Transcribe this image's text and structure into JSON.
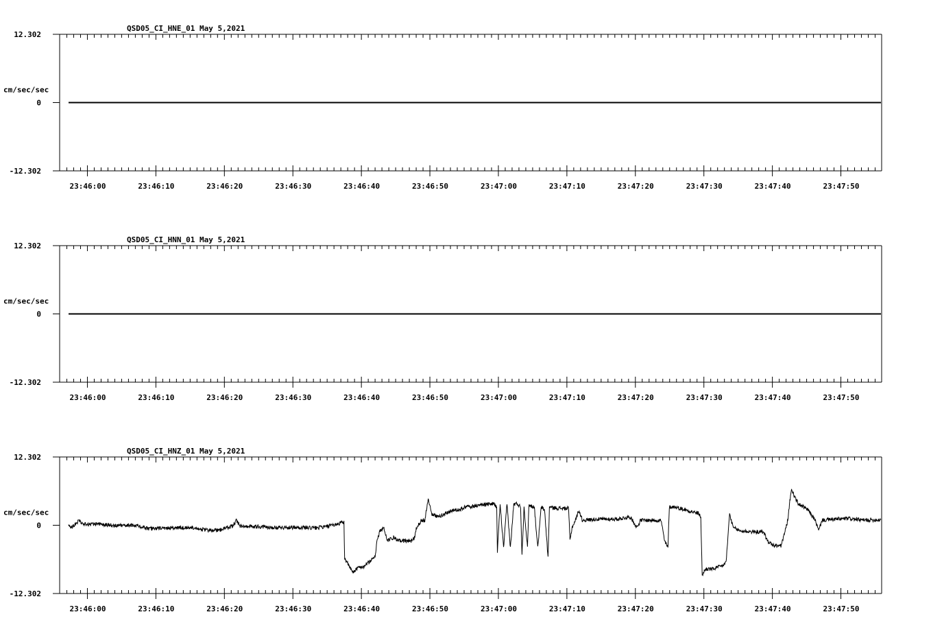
{
  "chart_data": [
    {
      "type": "line",
      "title": "QSD05_CI_HNE_01  May 5,2021",
      "ylabel": "cm/sec/sec",
      "ylim": [
        -12.302,
        12.302
      ],
      "yticks": [
        "12.302",
        "0",
        "-12.302"
      ],
      "x_start_time": "23:45:56",
      "x_range_seconds": [
        0,
        120
      ],
      "xtick_labels": [
        "23:46:00",
        "23:46:10",
        "23:46:20",
        "23:46:30",
        "23:46:40",
        "23:46:50",
        "23:47:00",
        "23:47:10",
        "23:47:20",
        "23:47:30",
        "23:47:40",
        "23:47:50"
      ],
      "series": [
        {
          "name": "HNE",
          "points": [
            [
              1.3,
              0
            ],
            [
              119.9,
              0
            ]
          ],
          "noise": 0
        }
      ]
    },
    {
      "type": "line",
      "title": "QSD05_CI_HNN_01  May 5,2021",
      "ylabel": "cm/sec/sec",
      "ylim": [
        -12.302,
        12.302
      ],
      "yticks": [
        "12.302",
        "0",
        "-12.302"
      ],
      "x_start_time": "23:45:56",
      "x_range_seconds": [
        0,
        120
      ],
      "xtick_labels": [
        "23:46:00",
        "23:46:10",
        "23:46:20",
        "23:46:30",
        "23:46:40",
        "23:46:50",
        "23:47:00",
        "23:47:10",
        "23:47:20",
        "23:47:30",
        "23:47:40",
        "23:47:50"
      ],
      "series": [
        {
          "name": "HNN",
          "points": [
            [
              1.3,
              0
            ],
            [
              119.9,
              0
            ]
          ],
          "noise": 0
        }
      ]
    },
    {
      "type": "line",
      "title": "QSD05_CI_HNZ_01  May 5,2021",
      "ylabel": "cm/sec/sec",
      "ylim": [
        -12.302,
        12.302
      ],
      "yticks": [
        "12.302",
        "0",
        "-12.302"
      ],
      "x_start_time": "23:45:56",
      "x_range_seconds": [
        0,
        120
      ],
      "xtick_labels": [
        "23:46:00",
        "23:46:10",
        "23:46:20",
        "23:46:30",
        "23:46:40",
        "23:46:50",
        "23:47:00",
        "23:47:10",
        "23:47:20",
        "23:47:30",
        "23:47:40",
        "23:47:50"
      ],
      "series": [
        {
          "name": "HNZ",
          "noise": 0.35,
          "points": [
            [
              1.3,
              0
            ],
            [
              1.8,
              -0.4
            ],
            [
              2.8,
              0.9
            ],
            [
              3.3,
              0.2
            ],
            [
              5.8,
              0.2
            ],
            [
              8.3,
              -0.1
            ],
            [
              11.3,
              0
            ],
            [
              12.8,
              -0.6
            ],
            [
              16.3,
              -0.5
            ],
            [
              19.8,
              -0.4
            ],
            [
              21.3,
              -0.9
            ],
            [
              23.3,
              -0.9
            ],
            [
              25.3,
              -0.1
            ],
            [
              25.8,
              0.9
            ],
            [
              26.3,
              -0.1
            ],
            [
              31.3,
              -0.4
            ],
            [
              34.3,
              -0.4
            ],
            [
              37.3,
              -0.5
            ],
            [
              39.3,
              -0.2
            ],
            [
              41.3,
              0.5
            ],
            [
              41.5,
              0.5
            ],
            [
              41.6,
              -5.9
            ],
            [
              42.3,
              -7.5
            ],
            [
              42.8,
              -8.5
            ],
            [
              43.3,
              -7.9
            ],
            [
              43.8,
              -7.5
            ],
            [
              44.3,
              -7.5
            ],
            [
              45.3,
              -6.5
            ],
            [
              46.1,
              -5.5
            ],
            [
              46.3,
              -2.8
            ],
            [
              46.8,
              -1.0
            ],
            [
              47.3,
              -0.4
            ],
            [
              47.8,
              -2.8
            ],
            [
              48.8,
              -2.2
            ],
            [
              49.3,
              -2.8
            ],
            [
              51.3,
              -2.8
            ],
            [
              51.8,
              -2.2
            ],
            [
              52.1,
              -0.4
            ],
            [
              52.8,
              0.9
            ],
            [
              53.3,
              0.9
            ],
            [
              53.8,
              4.8
            ],
            [
              54.1,
              3.3
            ],
            [
              54.3,
              2.1
            ],
            [
              55.3,
              1.5
            ],
            [
              56.3,
              2.1
            ],
            [
              57.3,
              2.7
            ],
            [
              58.3,
              2.7
            ],
            [
              59.3,
              3.3
            ],
            [
              61.3,
              3.6
            ],
            [
              63.3,
              3.9
            ],
            [
              63.8,
              3.3
            ],
            [
              63.9,
              -4.7
            ],
            [
              64.3,
              3.9
            ],
            [
              64.8,
              -4.1
            ],
            [
              65.3,
              3.9
            ],
            [
              65.8,
              -4.1
            ],
            [
              66.3,
              3.8
            ],
            [
              66.8,
              3.9
            ],
            [
              67.3,
              3.3
            ],
            [
              67.5,
              -5.3
            ],
            [
              67.8,
              3.3
            ],
            [
              68.3,
              -4.1
            ],
            [
              68.5,
              3.6
            ],
            [
              69.3,
              3.3
            ],
            [
              69.8,
              -4.1
            ],
            [
              70.3,
              3.3
            ],
            [
              70.8,
              2.7
            ],
            [
              71.3,
              -5.9
            ],
            [
              71.5,
              3.3
            ],
            [
              72.3,
              3.1
            ],
            [
              74.3,
              3.0
            ],
            [
              74.5,
              -2.8
            ],
            [
              74.8,
              -0.4
            ],
            [
              75.3,
              0.9
            ],
            [
              75.8,
              2.7
            ],
            [
              76.3,
              0.9
            ],
            [
              78.3,
              1.1
            ],
            [
              81.3,
              1.1
            ],
            [
              83.3,
              1.5
            ],
            [
              84.3,
              -0.4
            ],
            [
              84.8,
              0.9
            ],
            [
              87.3,
              0.9
            ],
            [
              87.8,
              0.9
            ],
            [
              88.3,
              -2.8
            ],
            [
              88.8,
              -4.1
            ],
            [
              89.0,
              3.3
            ],
            [
              89.8,
              3.3
            ],
            [
              93.3,
              2.1
            ],
            [
              93.6,
              1.5
            ],
            [
              93.8,
              -9.0
            ],
            [
              94.3,
              -7.9
            ],
            [
              95.3,
              -7.9
            ],
            [
              96.8,
              -7.3
            ],
            [
              97.3,
              -6.6
            ],
            [
              97.8,
              2.1
            ],
            [
              98.3,
              -0.4
            ],
            [
              99.3,
              -1.0
            ],
            [
              101.3,
              -1.2
            ],
            [
              102.8,
              -1.2
            ],
            [
              103.3,
              -2.8
            ],
            [
              104.3,
              -3.7
            ],
            [
              105.3,
              -3.7
            ],
            [
              105.8,
              -1.6
            ],
            [
              106.3,
              0.9
            ],
            [
              106.8,
              6.5
            ],
            [
              107.8,
              3.9
            ],
            [
              109.3,
              2.7
            ],
            [
              110.3,
              0.9
            ],
            [
              110.8,
              -1.0
            ],
            [
              111.3,
              0.9
            ],
            [
              113.3,
              1.1
            ],
            [
              115.3,
              1.2
            ],
            [
              117.3,
              0.9
            ],
            [
              119.9,
              1.0
            ]
          ]
        }
      ]
    }
  ]
}
